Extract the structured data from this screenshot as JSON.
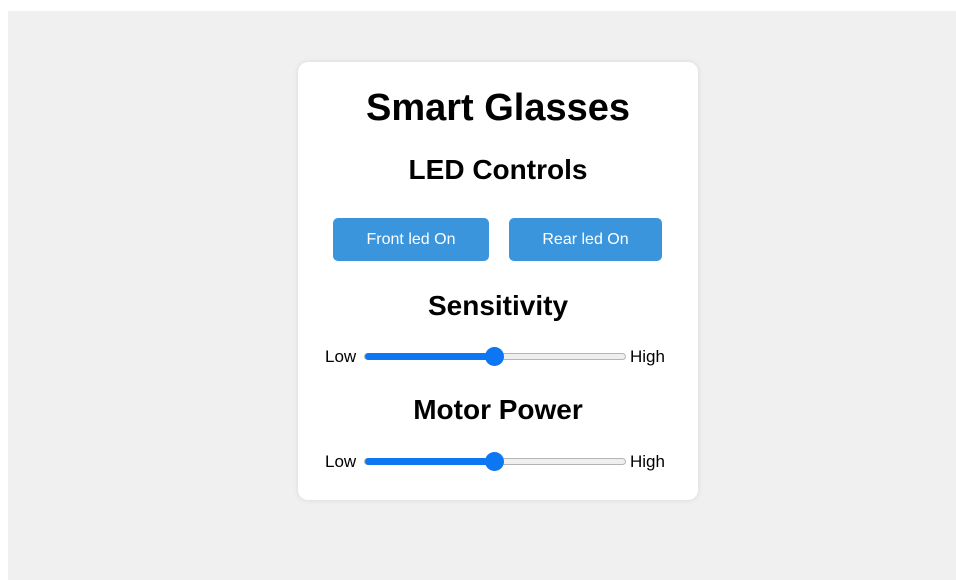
{
  "app": {
    "title": "Smart Glasses"
  },
  "led_controls": {
    "heading": "LED Controls",
    "front_button_label": "Front led On",
    "rear_button_label": "Rear led On"
  },
  "sensitivity": {
    "heading": "Sensitivity",
    "low_label": "Low",
    "high_label": "High",
    "value_fraction": 0.5
  },
  "motor_power": {
    "heading": "Motor Power",
    "low_label": "Low",
    "high_label": "High",
    "value_fraction": 0.5
  },
  "colors": {
    "accent": "#0d76f2",
    "button": "#3a95dd",
    "page_background": "#f0f0f0",
    "card_background": "#ffffff"
  }
}
